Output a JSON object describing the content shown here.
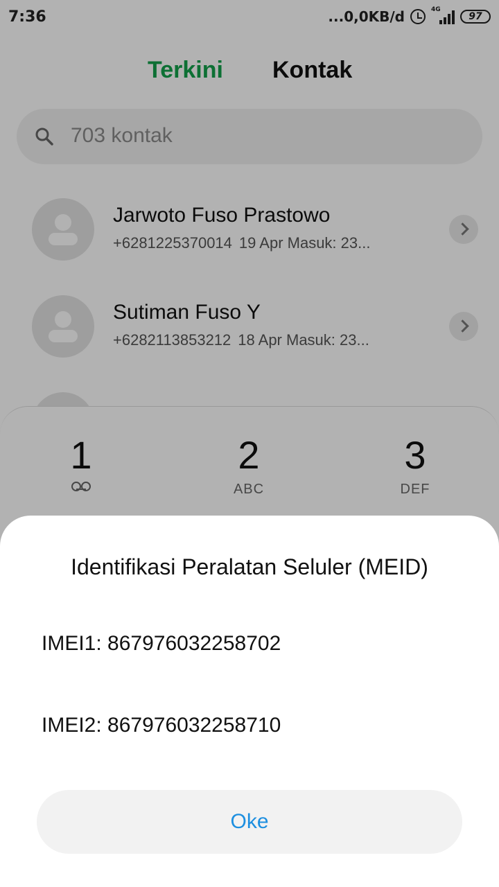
{
  "status_bar": {
    "time": "7:36",
    "network_speed": "...0,0KB/d",
    "network_type": "4G",
    "battery": "97"
  },
  "tabs": {
    "recent": "Terkini",
    "contacts": "Kontak",
    "active_color": "#13a14b"
  },
  "search": {
    "placeholder": "703 kontak"
  },
  "contacts": [
    {
      "name": "Jarwoto Fuso Prastowo",
      "number": "+6281225370014",
      "detail": "19 Apr Masuk: 23..."
    },
    {
      "name": "Sutiman Fuso Y",
      "number": "+6282113853212",
      "detail": "18 Apr Masuk: 23..."
    }
  ],
  "dialpad": {
    "keys": [
      {
        "num": "1",
        "letters": ""
      },
      {
        "num": "2",
        "letters": "ABC"
      },
      {
        "num": "3",
        "letters": "DEF"
      }
    ]
  },
  "dialog": {
    "title": "Identifikasi Peralatan Seluler (MEID)",
    "imei1": "IMEI1: 867976032258702",
    "imei2": "IMEI2: 867976032258710",
    "ok_label": "Oke",
    "ok_color": "#1d8fe0"
  }
}
